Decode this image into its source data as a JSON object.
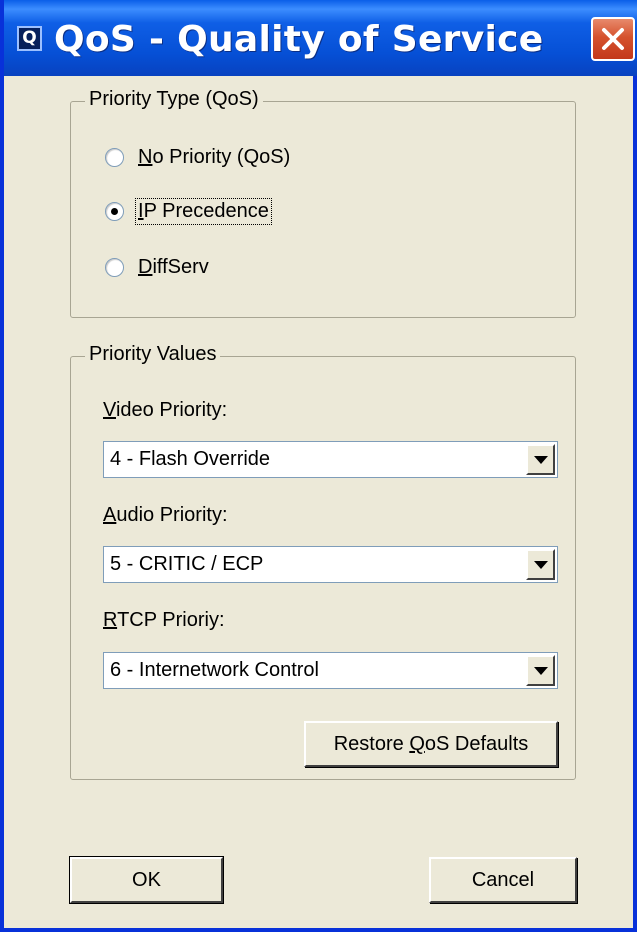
{
  "window": {
    "title": "QoS - Quality of Service",
    "icon_letter": "Q",
    "icon": "app-icon",
    "close_icon": "close-icon"
  },
  "priority_type": {
    "legend": "Priority Type (QoS)",
    "options": [
      {
        "label": "No Priority (QoS)",
        "mnemonic": "N",
        "rest": "o Priority (QoS)",
        "selected": false
      },
      {
        "label": "IP Precedence",
        "mnemonic": "I",
        "rest": "P Precedence",
        "selected": true
      },
      {
        "label": "DiffServ",
        "mnemonic": "D",
        "rest": "iffServ",
        "selected": false
      }
    ]
  },
  "priority_values": {
    "legend": "Priority Values",
    "video": {
      "label_mnemonic": "V",
      "label_rest": "ideo Priority:",
      "value": "4 - Flash Override"
    },
    "audio": {
      "label_mnemonic": "A",
      "label_rest": "udio Priority:",
      "value": "5 - CRITIC / ECP"
    },
    "rtcp": {
      "label_mnemonic": "R",
      "label_rest": "TCP Prioriy:",
      "value": "6 - Internetwork Control"
    },
    "restore_button": {
      "prefix": "Restore ",
      "mnemonic": "Q",
      "suffix": "oS Defaults"
    }
  },
  "buttons": {
    "ok": "OK",
    "cancel": "Cancel"
  },
  "colors": {
    "titlebar": "#0650d6",
    "face": "#ece9d8",
    "close": "#d5522e"
  }
}
